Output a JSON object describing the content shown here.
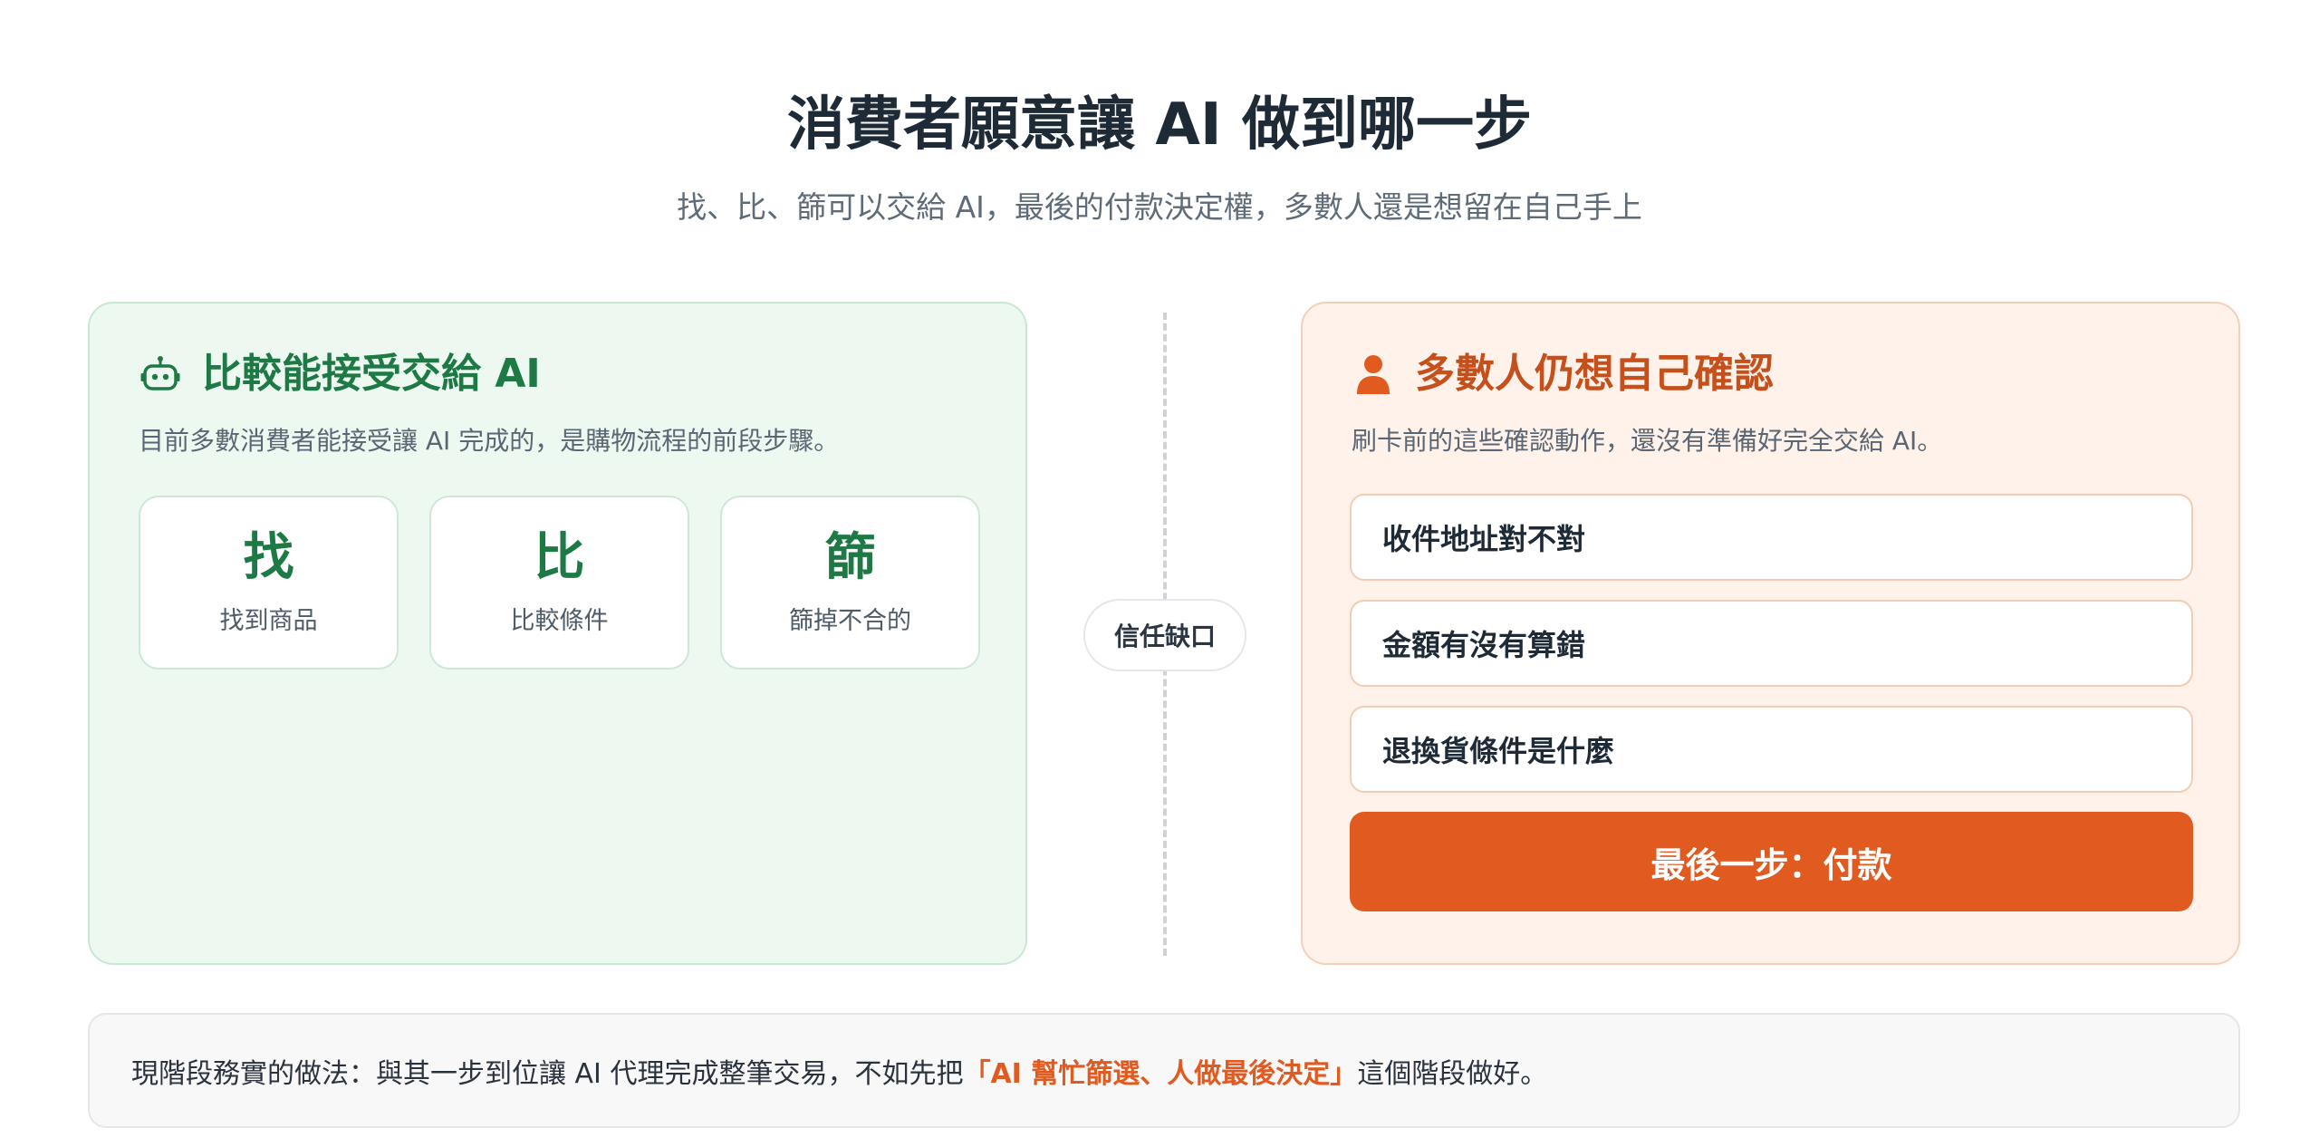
{
  "header": {
    "title": "消費者願意讓 AI 做到哪一步",
    "subtitle": "找、比、篩可以交給 AI，最後的付款決定權，多數人還是想留在自己手上"
  },
  "left_card": {
    "icon": "robot-icon",
    "title": "比較能接受交給 AI",
    "description": "目前多數消費者能接受讓 AI 完成的，是購物流程的前段步驟。",
    "steps": [
      {
        "char": "找",
        "label": "找到商品"
      },
      {
        "char": "比",
        "label": "比較條件"
      },
      {
        "char": "篩",
        "label": "篩掉不合的"
      }
    ]
  },
  "divider": {
    "label": "信任缺口"
  },
  "right_card": {
    "icon": "person-icon",
    "title": "多數人仍想自己確認",
    "description": "刷卡前的這些確認動作，還沒有準備好完全交給 AI。",
    "checks": [
      "收件地址對不對",
      "金額有沒有算錯",
      "退換貨條件是什麼"
    ],
    "final_step": "最後一步：付款"
  },
  "footer": {
    "prefix": "現階段務實的做法：與其一步到位讓 AI 代理完成整筆交易，不如先把",
    "highlight": "「AI 幫忙篩選、人做最後決定」",
    "suffix": "這個階段做好。"
  },
  "colors": {
    "green_accent": "#1e7a45",
    "orange_accent": "#e15a1f",
    "text_dark": "#1f2a37"
  }
}
